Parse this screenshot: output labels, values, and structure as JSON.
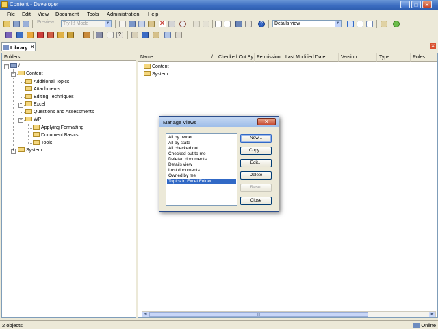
{
  "window": {
    "title": "Content - Developer",
    "min": "_",
    "max": "□",
    "close": "✕"
  },
  "menu": [
    "File",
    "Edit",
    "View",
    "Document",
    "Tools",
    "Administration",
    "Help"
  ],
  "toolbar": {
    "preview_label": "Preview",
    "mode_value": "Try It! Mode",
    "view_value": "Details view"
  },
  "tab": {
    "label": "Library",
    "close": "✕"
  },
  "folders": {
    "header": "Folders",
    "tree": [
      {
        "label": "/",
        "expander": "−"
      },
      {
        "label": "Content",
        "expander": "−"
      },
      {
        "label": "Additional Topics"
      },
      {
        "label": "Attachments"
      },
      {
        "label": "Editing Techniques"
      },
      {
        "label": "Excel",
        "expander": "+"
      },
      {
        "label": "Questions and Assessments"
      },
      {
        "label": "WP",
        "expander": "−"
      },
      {
        "label": "Applying Formatting"
      },
      {
        "label": "Document Basics"
      },
      {
        "label": "Tools"
      },
      {
        "label": "System",
        "expander": "+"
      }
    ]
  },
  "list": {
    "columns": [
      "Name",
      "/",
      "Checked Out By",
      "Permission",
      "Last Modified Date",
      "Version",
      "Type",
      "Roles"
    ],
    "items": [
      "Content",
      "System"
    ]
  },
  "dialog": {
    "title": "Manage Views",
    "close": "✕",
    "views": [
      "All by owner",
      "All by state",
      "All checked out",
      "Checked out to me",
      "Deleted documents",
      "Details view",
      "Lost documents",
      "Owned by me",
      "Topics in Excel Folder"
    ],
    "selected_index": 8,
    "buttons": {
      "new": "New...",
      "copy": "Copy...",
      "edit": "Edit...",
      "delete": "Delete",
      "reset": "Reset",
      "close": "Close"
    }
  },
  "status": {
    "count": "2 objects",
    "mode": "Online"
  }
}
